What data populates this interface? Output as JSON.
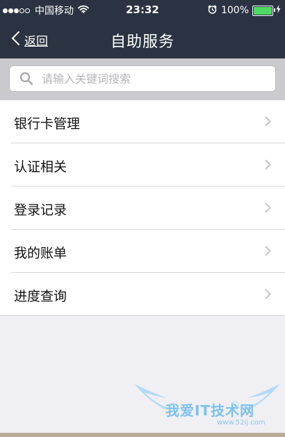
{
  "status_bar": {
    "signal": {
      "filled": 3,
      "total": 5
    },
    "carrier": "中国移动",
    "time": "23:32",
    "battery_percent": "100%",
    "battery_level": 1.0,
    "icons": [
      "signal-dots",
      "wifi-icon",
      "alarm-icon",
      "battery-icon",
      "charging-icon"
    ]
  },
  "nav": {
    "back_label": "返回",
    "title": "自助服务"
  },
  "search": {
    "placeholder": "请输入关键词搜索"
  },
  "menu": {
    "items": [
      {
        "label": "银行卡管理"
      },
      {
        "label": "认证相关"
      },
      {
        "label": "登录记录"
      },
      {
        "label": "我的账单"
      },
      {
        "label": "进度查询"
      }
    ]
  },
  "watermark": {
    "text": "我爱IT技术网",
    "url": "www.52ij.com"
  },
  "colors": {
    "nav_background": "#2b3343",
    "search_area_background": "#c9c9ce",
    "page_background": "#efeff4",
    "battery_green": "#4cd964",
    "watermark_blue": "#7fc2ea"
  }
}
